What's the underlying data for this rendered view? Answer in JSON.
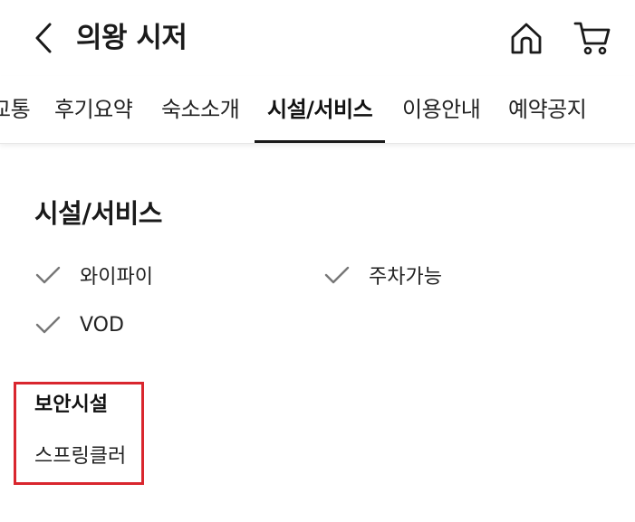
{
  "header": {
    "title": "의왕 시저",
    "back_icon": "chevron-left-icon",
    "home_icon": "home-icon",
    "cart_icon": "cart-icon"
  },
  "tabs": [
    {
      "label": "교통",
      "active": false
    },
    {
      "label": "후기요약",
      "active": false
    },
    {
      "label": "숙소소개",
      "active": false
    },
    {
      "label": "시설/서비스",
      "active": true
    },
    {
      "label": "이용안내",
      "active": false
    },
    {
      "label": "예약공지",
      "active": false
    }
  ],
  "main": {
    "section_title": "시설/서비스",
    "facilities": [
      "와이파이",
      "주차가능",
      "VOD"
    ],
    "security": {
      "label": "보안시설",
      "value": "스프링클러"
    }
  },
  "colors": {
    "highlight_border": "#d9262e",
    "text": "#1a1a1a",
    "check_icon": "#777777"
  }
}
